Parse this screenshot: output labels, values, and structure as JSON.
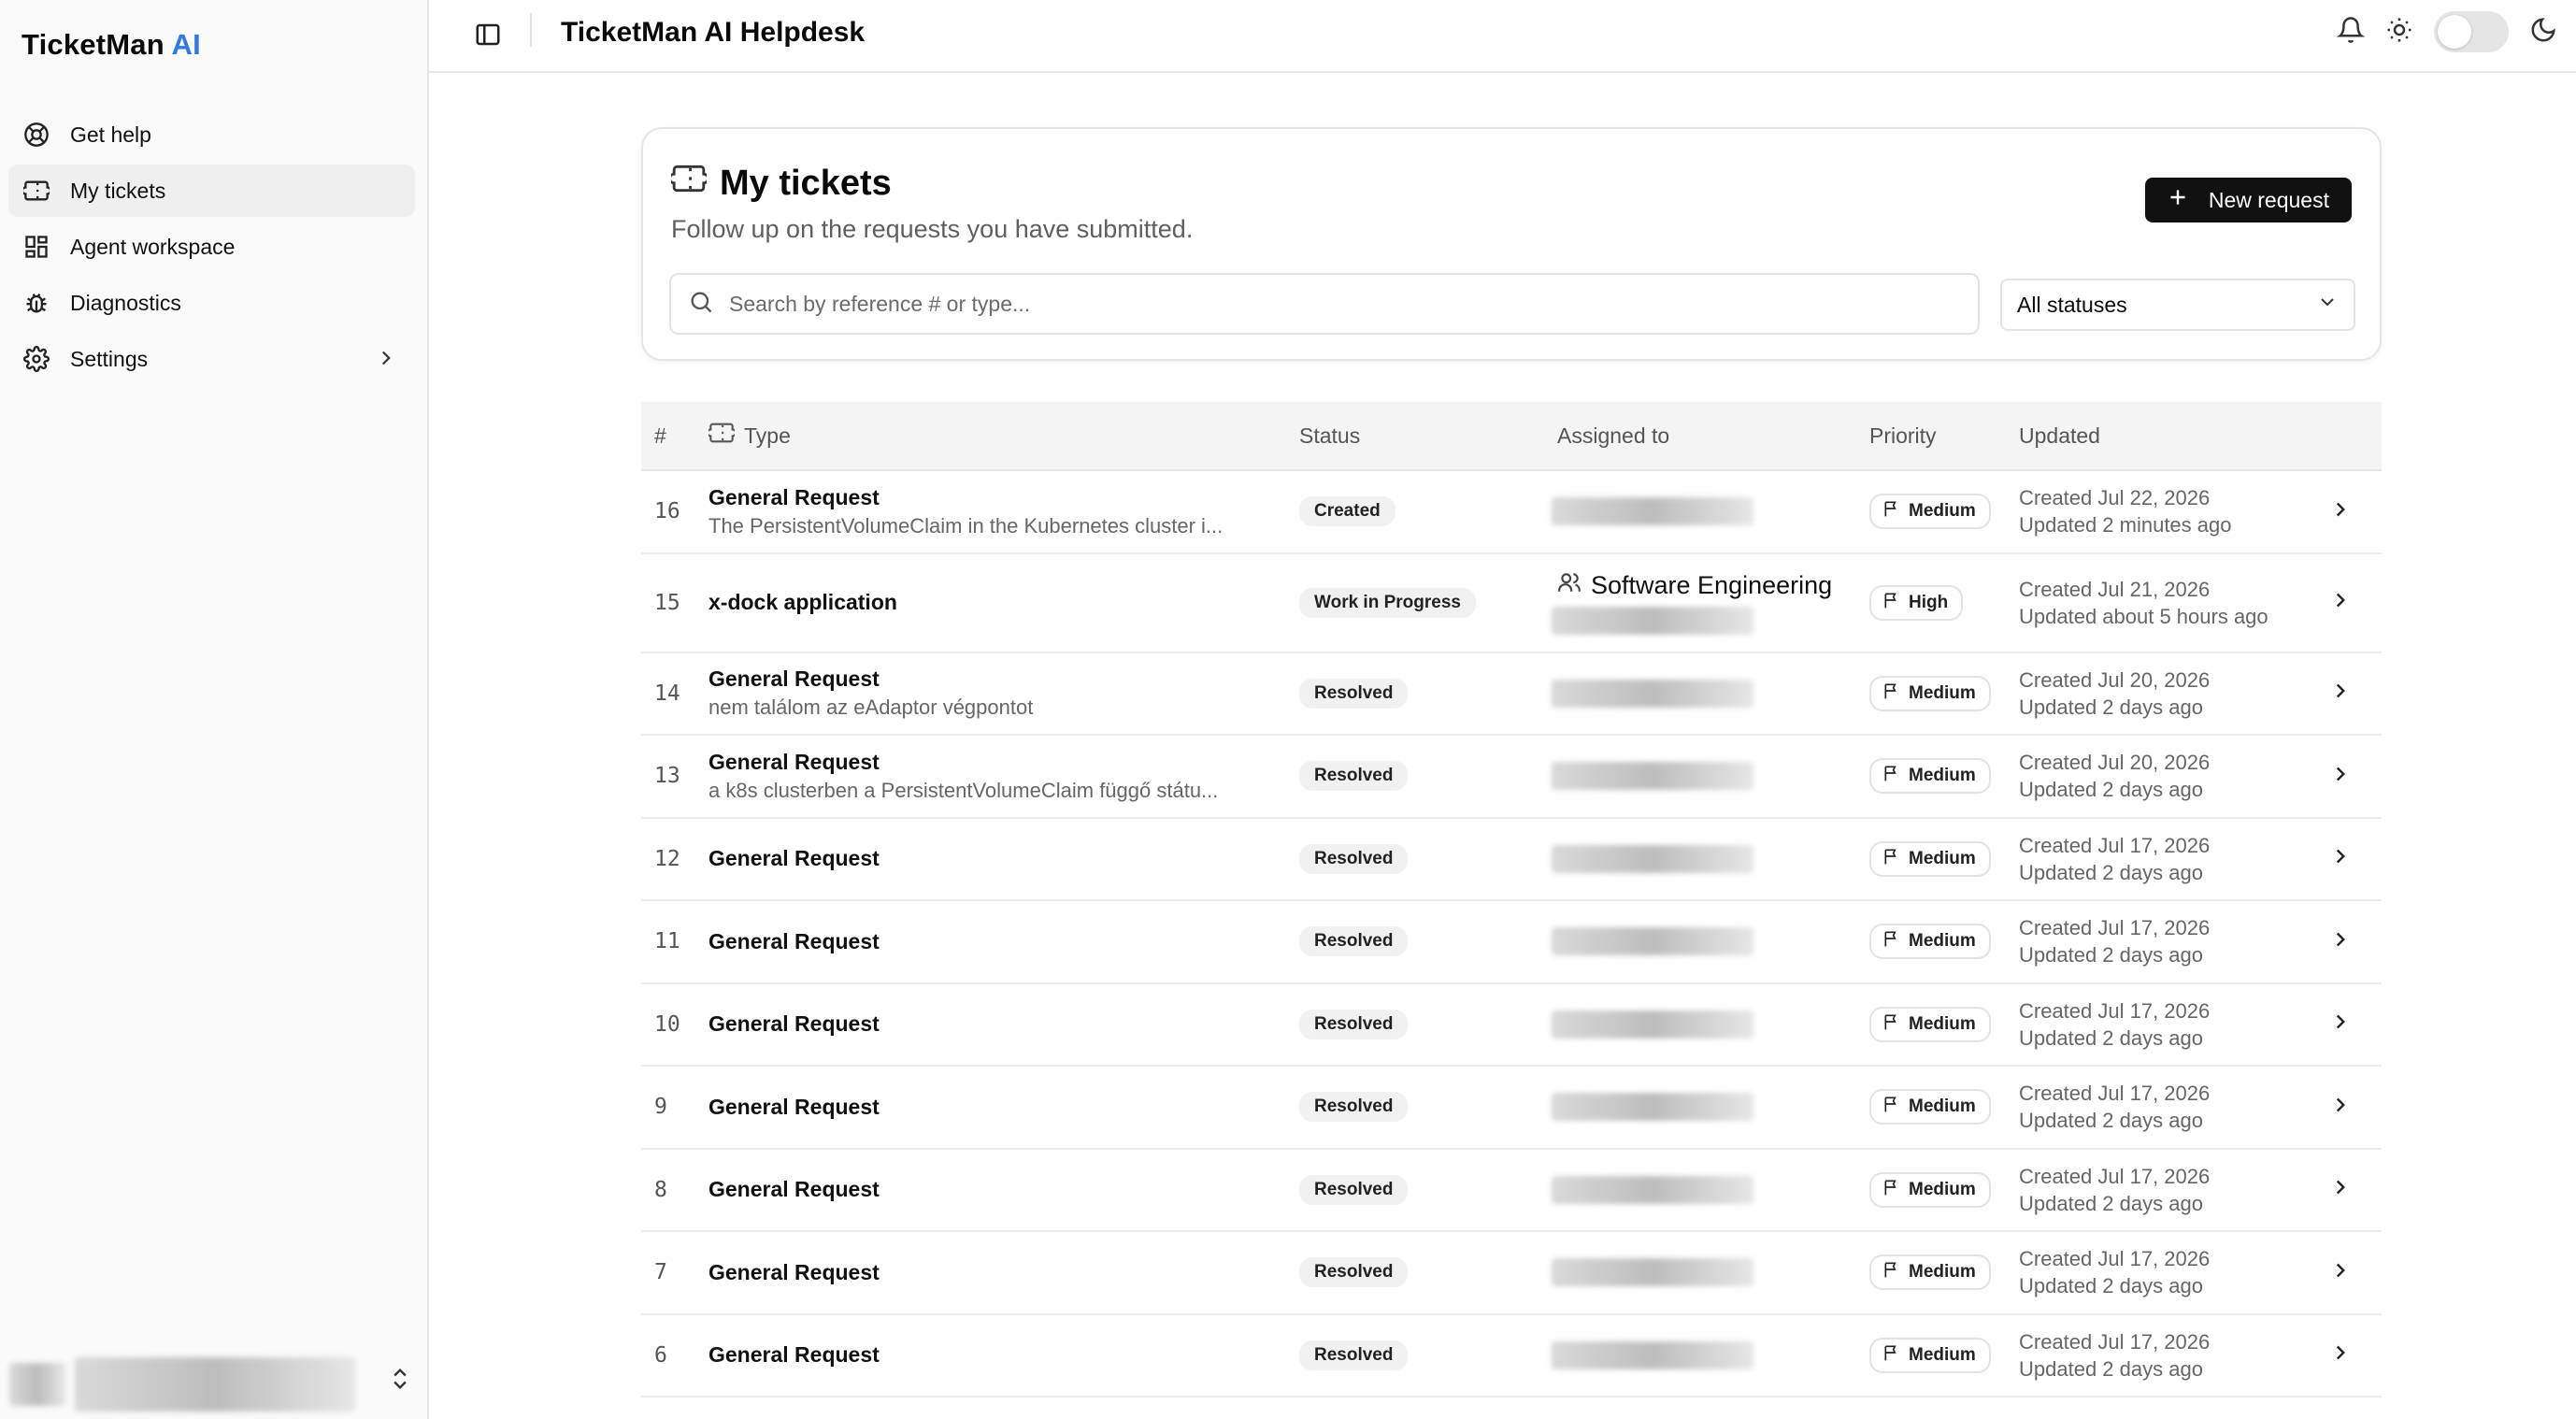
{
  "brand": {
    "name": "TicketMan",
    "suffix": "AI"
  },
  "sidebar": {
    "items": [
      {
        "label": "Get help",
        "icon": "lifebuoy-icon"
      },
      {
        "label": "My tickets",
        "icon": "ticket-icon",
        "active": true
      },
      {
        "label": "Agent workspace",
        "icon": "dashboard-icon"
      },
      {
        "label": "Diagnostics",
        "icon": "bug-icon"
      },
      {
        "label": "Settings",
        "icon": "gear-icon",
        "has_submenu": true
      }
    ]
  },
  "header": {
    "title": "TicketMan AI Helpdesk"
  },
  "page": {
    "title": "My tickets",
    "subtitle": "Follow up on the requests you have submitted.",
    "new_request_label": "New request",
    "search_placeholder": "Search by reference # or type...",
    "status_filter": "All statuses"
  },
  "table": {
    "headers": {
      "num": "#",
      "type": "Type",
      "status": "Status",
      "assigned": "Assigned to",
      "priority": "Priority",
      "updated": "Updated"
    },
    "rows": [
      {
        "num": "16",
        "type": "General Request",
        "desc": "The PersistentVolumeClaim in the Kubernetes cluster i...",
        "status": "Created",
        "team": "",
        "priority": "Medium",
        "created": "Created Jul 22, 2026",
        "updated": "Updated 2 minutes ago"
      },
      {
        "num": "15",
        "type": "x-dock application",
        "desc": "",
        "status": "Work in Progress",
        "team": "Software Engineering",
        "priority": "High",
        "created": "Created Jul 21, 2026",
        "updated": "Updated about 5 hours ago"
      },
      {
        "num": "14",
        "type": "General Request",
        "desc": "nem találom az eAdaptor végpontot",
        "status": "Resolved",
        "team": "",
        "priority": "Medium",
        "created": "Created Jul 20, 2026",
        "updated": "Updated 2 days ago"
      },
      {
        "num": "13",
        "type": "General Request",
        "desc": "a k8s clusterben a PersistentVolumeClaim függő státu...",
        "status": "Resolved",
        "team": "",
        "priority": "Medium",
        "created": "Created Jul 20, 2026",
        "updated": "Updated 2 days ago"
      },
      {
        "num": "12",
        "type": "General Request",
        "desc": "",
        "status": "Resolved",
        "team": "",
        "priority": "Medium",
        "created": "Created Jul 17, 2026",
        "updated": "Updated 2 days ago"
      },
      {
        "num": "11",
        "type": "General Request",
        "desc": "",
        "status": "Resolved",
        "team": "",
        "priority": "Medium",
        "created": "Created Jul 17, 2026",
        "updated": "Updated 2 days ago"
      },
      {
        "num": "10",
        "type": "General Request",
        "desc": "",
        "status": "Resolved",
        "team": "",
        "priority": "Medium",
        "created": "Created Jul 17, 2026",
        "updated": "Updated 2 days ago"
      },
      {
        "num": "9",
        "type": "General Request",
        "desc": "",
        "status": "Resolved",
        "team": "",
        "priority": "Medium",
        "created": "Created Jul 17, 2026",
        "updated": "Updated 2 days ago"
      },
      {
        "num": "8",
        "type": "General Request",
        "desc": "",
        "status": "Resolved",
        "team": "",
        "priority": "Medium",
        "created": "Created Jul 17, 2026",
        "updated": "Updated 2 days ago"
      },
      {
        "num": "7",
        "type": "General Request",
        "desc": "",
        "status": "Resolved",
        "team": "",
        "priority": "Medium",
        "created": "Created Jul 17, 2026",
        "updated": "Updated 2 days ago"
      },
      {
        "num": "6",
        "type": "General Request",
        "desc": "",
        "status": "Resolved",
        "team": "",
        "priority": "Medium",
        "created": "Created Jul 17, 2026",
        "updated": "Updated 2 days ago"
      }
    ]
  },
  "colors": {
    "accent": "#2f7be6",
    "primary_button": "#111111"
  }
}
